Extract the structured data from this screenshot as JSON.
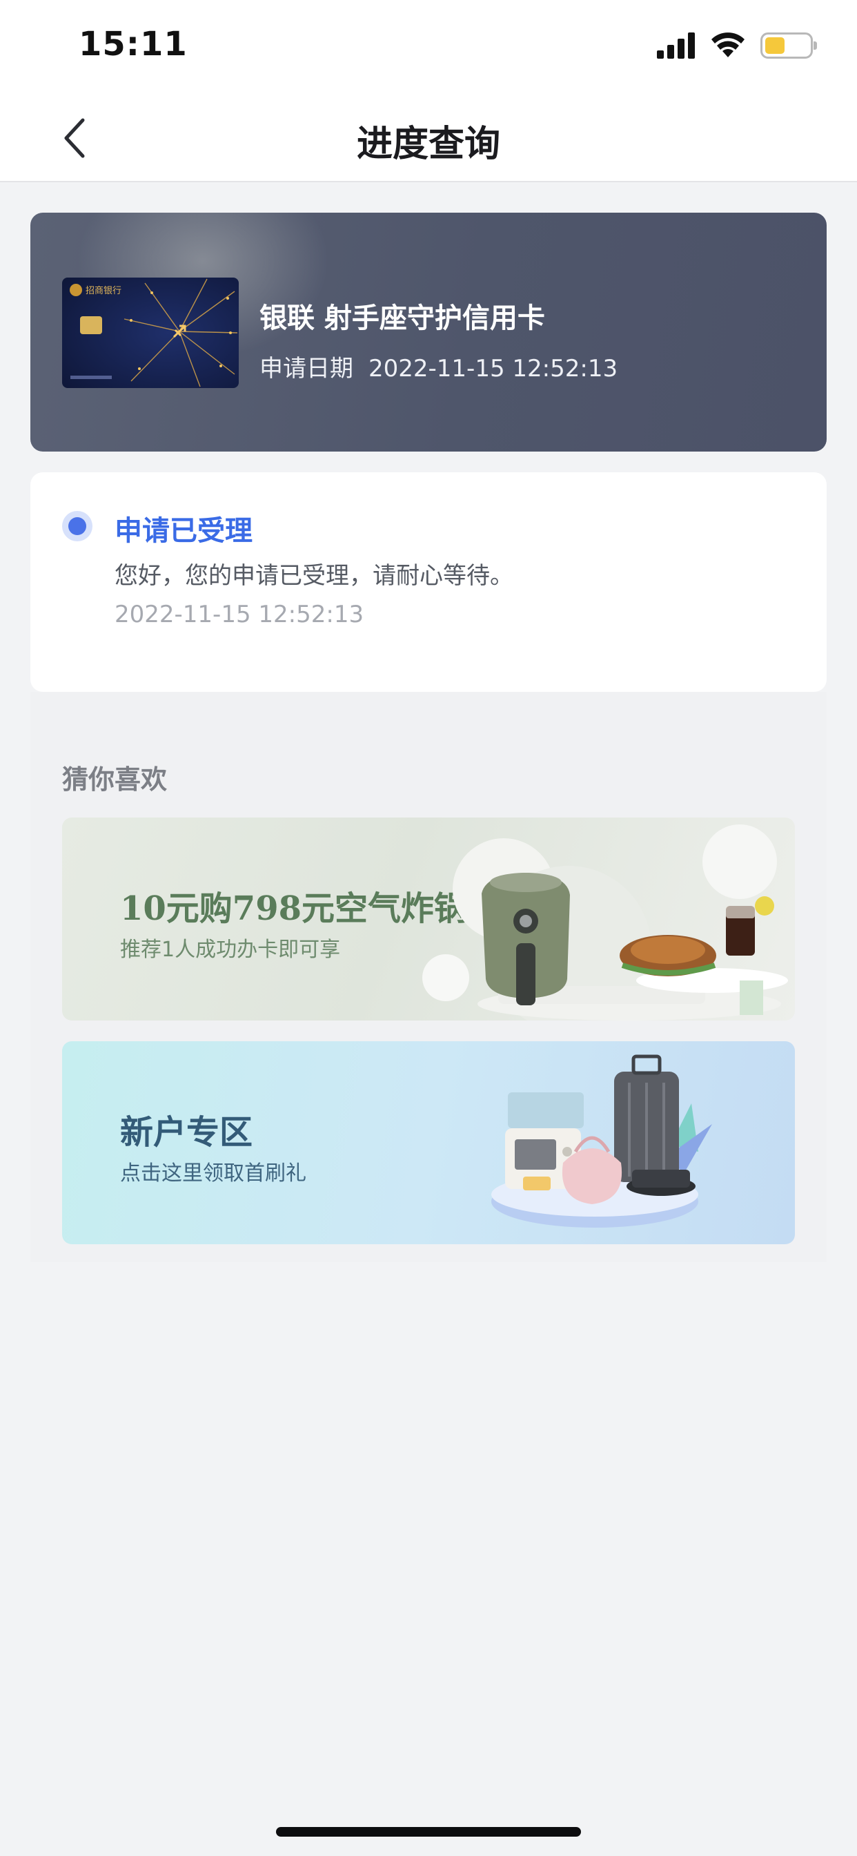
{
  "status_bar": {
    "time": "15:11",
    "icons": [
      "cellular-signal-icon",
      "wifi-icon",
      "battery-icon"
    ],
    "battery_level": 0.4
  },
  "nav": {
    "title": "进度查询",
    "back_icon": "chevron-left-icon"
  },
  "card": {
    "name": "银联 射手座守护信用卡",
    "date_label": "申请日期",
    "date_value": "2022-11-15 12:52:13",
    "card_image_text": "招商银行"
  },
  "progress": {
    "status": "申请已受理",
    "message": "您好，您的申请已受理，请耐心等待。",
    "time": "2022-11-15 12:52:13",
    "status_color": "#3a6be6"
  },
  "recommend": {
    "title": "猜你喜欢",
    "banners": [
      {
        "title": "10元购798元空气炸锅",
        "subtitle": "推荐1人成功办卡即可享"
      },
      {
        "title": "新户专区",
        "subtitle": "点击这里领取首刷礼"
      }
    ]
  }
}
